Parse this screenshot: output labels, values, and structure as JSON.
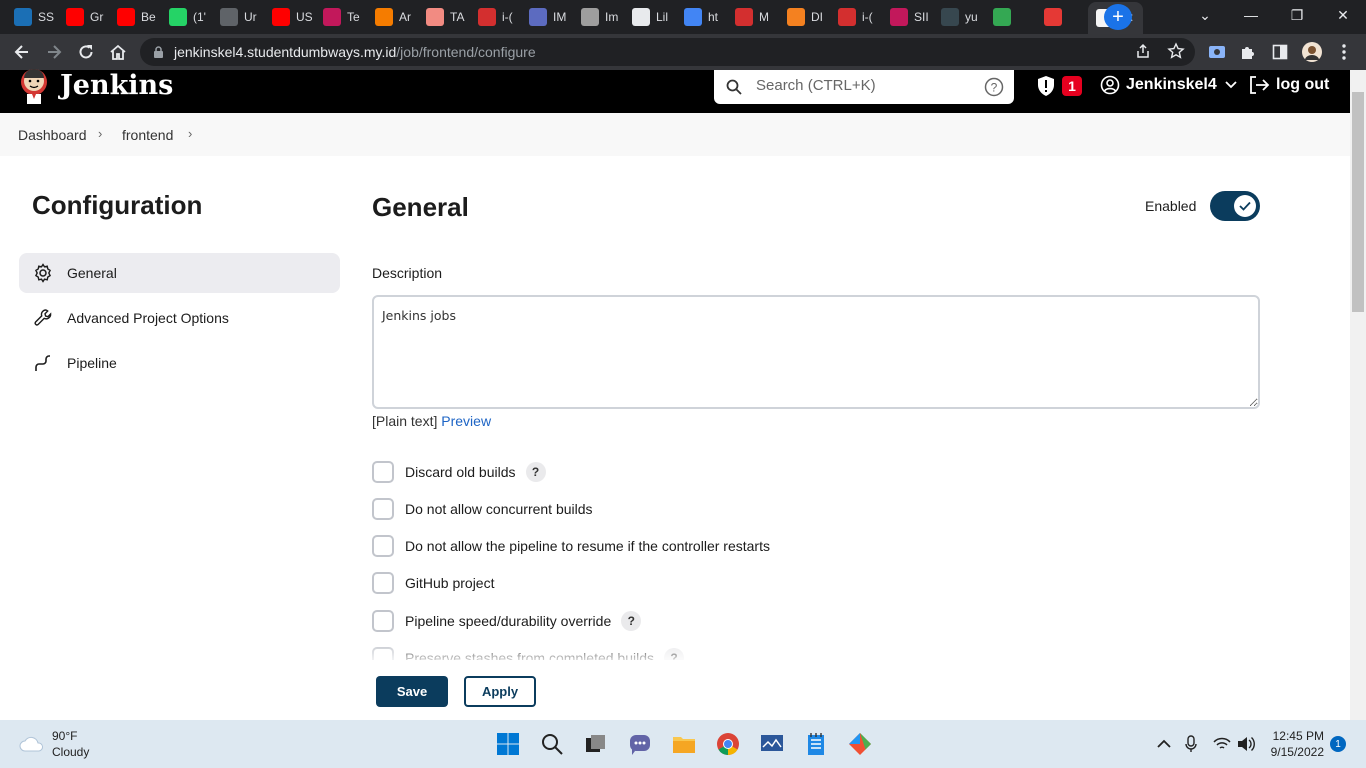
{
  "browser": {
    "tabs": [
      {
        "title": "SS",
        "color": "#1b6fb5",
        "icon": "github-icon"
      },
      {
        "title": "Gr",
        "color": "#ff0000",
        "icon": "youtube-icon"
      },
      {
        "title": "Be",
        "color": "#ff0000",
        "icon": "youtube-icon"
      },
      {
        "title": "(1'",
        "color": "#25d366",
        "icon": "whatsapp-icon"
      },
      {
        "title": "Ur",
        "color": "#5f6368",
        "icon": "globe-icon"
      },
      {
        "title": "US",
        "color": "#ff0000",
        "icon": "youtube-icon"
      },
      {
        "title": "Te",
        "color": "#c2185b",
        "icon": "infinity-icon"
      },
      {
        "title": "Ar",
        "color": "#f57c00",
        "icon": "box-icon"
      },
      {
        "title": "TA",
        "color": "#f28b82",
        "icon": "ta-icon"
      },
      {
        "title": "i-(",
        "color": "#d32f2f",
        "icon": "gitlab-icon"
      },
      {
        "title": "IM",
        "color": "#5c6bc0",
        "icon": "diamond-icon"
      },
      {
        "title": "Im",
        "color": "#9e9e9e",
        "icon": "gear-icon"
      },
      {
        "title": "Lil",
        "color": "#e8eaed",
        "icon": "document-icon"
      },
      {
        "title": "ht",
        "color": "#4285f4",
        "icon": "google-icon"
      },
      {
        "title": "M",
        "color": "#d32f2f",
        "icon": "infinity-icon"
      },
      {
        "title": "DI",
        "color": "#f48120",
        "icon": "cloudflare-icon"
      },
      {
        "title": "i-(",
        "color": "#d32f2f",
        "icon": "gitlab-icon"
      },
      {
        "title": "SII",
        "color": "#c2185b",
        "icon": "infinity-icon"
      },
      {
        "title": "yu",
        "color": "#37474f",
        "icon": "moon-icon"
      },
      {
        "title": "",
        "color": "#34a853",
        "icon": "meet-icon"
      },
      {
        "title": "",
        "color": "#e53935",
        "icon": "record-icon"
      },
      {
        "title": "",
        "color": "#f5f5f5",
        "icon": "jenkins-icon"
      }
    ],
    "url_host": "jenkinskel4.studentdumbways.my.id",
    "url_path": "/job/frontend/configure"
  },
  "header": {
    "brand": "Jenkins",
    "search_placeholder": "Search (CTRL+K)",
    "alert_count": "1",
    "username": "Jenkinskel4",
    "logout": "log out"
  },
  "breadcrumb": [
    "Dashboard",
    "frontend"
  ],
  "sidebar": {
    "title": "Configuration",
    "items": [
      {
        "label": "General",
        "icon": "gear-icon",
        "active": true
      },
      {
        "label": "Advanced Project Options",
        "icon": "wrench-icon",
        "active": false
      },
      {
        "label": "Pipeline",
        "icon": "pipeline-icon",
        "active": false
      }
    ]
  },
  "general": {
    "title": "General",
    "enabled_label": "Enabled",
    "enabled": true,
    "description_label": "Description",
    "description_value": "Jenkins jobs",
    "plain_text": "[Plain text]",
    "preview": "Preview",
    "options": [
      {
        "label": "Discard old builds",
        "help": true,
        "checked": false
      },
      {
        "label": "Do not allow concurrent builds",
        "help": false,
        "checked": false
      },
      {
        "label": "Do not allow the pipeline to resume if the controller restarts",
        "help": false,
        "checked": false
      },
      {
        "label": "GitHub project",
        "help": false,
        "checked": false
      },
      {
        "label": "Pipeline speed/durability override",
        "help": true,
        "checked": false
      },
      {
        "label": "Preserve stashes from completed builds",
        "help": true,
        "checked": false
      }
    ],
    "help_glyph": "?"
  },
  "actions": {
    "save": "Save",
    "apply": "Apply"
  },
  "taskbar": {
    "temp": "90°F",
    "weather": "Cloudy",
    "time": "12:45 PM",
    "date": "9/15/2022",
    "notifications": "1"
  },
  "colors": {
    "accent": "#0b3c5d",
    "link": "#1d64c5",
    "alert": "#e6001f"
  }
}
